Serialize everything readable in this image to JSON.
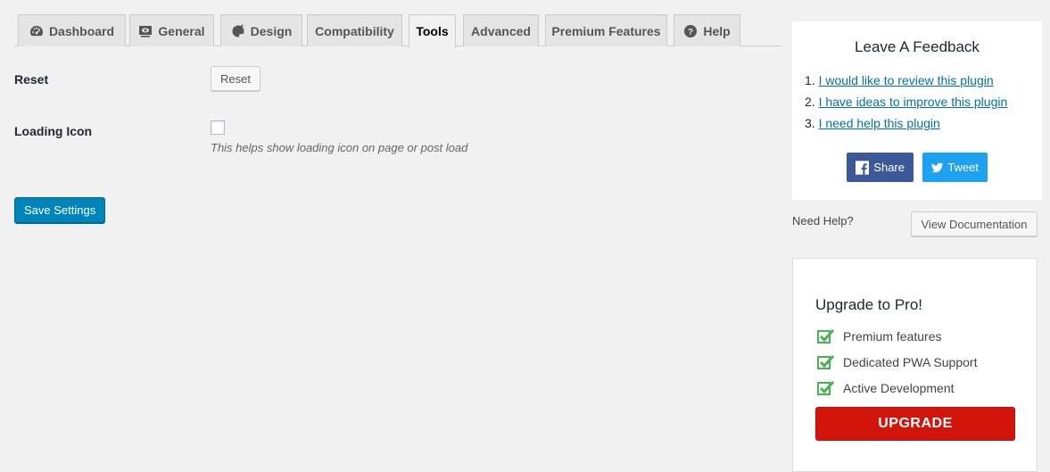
{
  "tabs": [
    {
      "label": "Dashboard",
      "icon": "dashboard-icon"
    },
    {
      "label": "General",
      "icon": "general-icon"
    },
    {
      "label": "Design",
      "icon": "design-icon"
    },
    {
      "label": "Compatibility",
      "icon": ""
    },
    {
      "label": "Tools",
      "icon": "",
      "active": true
    },
    {
      "label": "Advanced",
      "icon": ""
    },
    {
      "label": "Premium Features",
      "icon": ""
    },
    {
      "label": "Help",
      "icon": "help-icon"
    }
  ],
  "form": {
    "reset_label": "Reset",
    "reset_button": "Reset",
    "loading_label": "Loading Icon",
    "loading_checked": false,
    "loading_desc": "This helps show loading icon on page or post load",
    "save_button": "Save Settings"
  },
  "feedback": {
    "title": "Leave A Feedback",
    "items": [
      {
        "num": "1.",
        "text": "I would like to review this plugin"
      },
      {
        "num": "2.",
        "text": "I have ideas to improve this plugin"
      },
      {
        "num": "3.",
        "text": "I need help this plugin"
      }
    ],
    "share": "Share",
    "tweet": "Tweet"
  },
  "help": {
    "label": "Need Help?",
    "doc_button": "View Documentation"
  },
  "upgrade": {
    "title": "Upgrade to Pro!",
    "features": [
      "Premium features",
      "Dedicated PWA Support",
      "Active Development"
    ],
    "button": "UPGRADE"
  },
  "colors": {
    "primary": "#0085ba",
    "link": "#0073aa",
    "facebook": "#3b5998",
    "twitter": "#1da1f2",
    "upgrade": "#d2140a",
    "check": "#46b450"
  }
}
